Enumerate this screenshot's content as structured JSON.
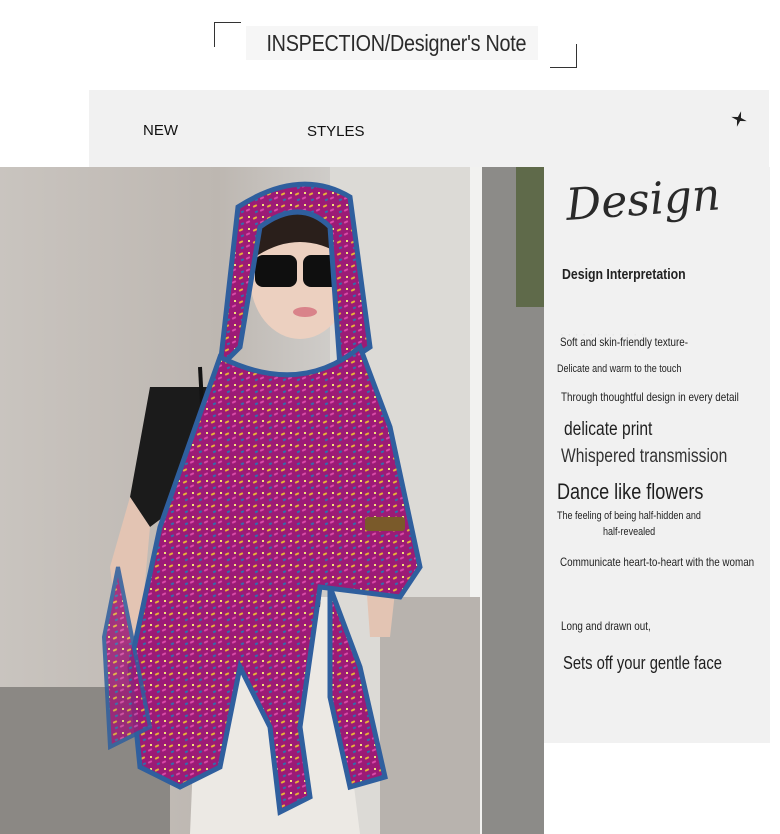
{
  "header": {
    "title": "INSPECTION/Designer's Note"
  },
  "band": {
    "new_label": "NEW",
    "styles_label": "STYLES",
    "star_icon": "sparkle-star-icon"
  },
  "panel": {
    "script_word": "Design",
    "heading": "Design Interpretation",
    "lines": [
      "Soft and skin-friendly texture-",
      "Delicate and warm to the touch",
      "Through thoughtful design in every detail",
      "delicate print",
      "Whispered transmission",
      "Dance like flowers",
      "The feeling of being half-hidden and",
      "half-revealed",
      "Communicate heart-to-heart with the woman",
      "Long and drawn out,",
      "Sets off your gentle face"
    ]
  },
  "colors": {
    "panel_bg": "#f1f1f1",
    "scarf_magenta": "#a81e7c",
    "scarf_border": "#2f5f9e"
  }
}
